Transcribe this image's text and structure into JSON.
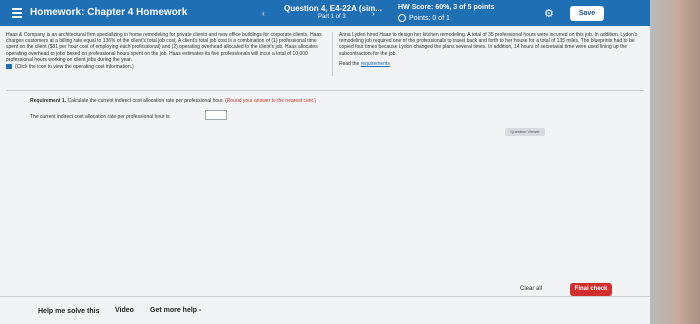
{
  "header": {
    "title": "Homework: Chapter 4 Homework",
    "question_title": "Question 4, E4-22A (sim...",
    "question_sub": "Part 1 of 3",
    "hw_score": "HW Score: 60%, 3 of 5 points",
    "points": "Points: 0 of 1",
    "save_label": "Save",
    "prev_icon": "‹",
    "next_icon": "›",
    "settings_icon": "⚙"
  },
  "problem": {
    "left_text": "Haas & Company is an architectural firm specializing in home remodeling for private clients and new office buildings for corporate clients. Haas charges customers at a billing rate equal to 136% of the client's total job cost. A client's total job cost is a combination of (1) professional time spent on the client ($81 per hour cost of employing each professional) and (2) operating overhead allocated to the client's job. Haas allocates operating overhead to jobs based on professional hours spent on the job. Haas estimates its five professionals will incur a total of 10,000 professional hours working on client jobs during the year.",
    "info_link": "(Click the icon to view the operating cost information.)",
    "right_text": "Anna Lydon hired Haas to design her kitchen remodeling. A total of 35 professional hours were incurred on this job. In addition, Lydon's remodeling job required one of the professionals to travel back and forth to her house for a total of 135 miles. The blueprints had to be copied four times because Lydon changed the plans several times. In addition, 14 hours of secretarial time were used lining up the subcontractors for the job.",
    "read_prefix": "Read the ",
    "requirements_link": "requirements"
  },
  "requirement": {
    "label": "Requirement 1.",
    "text": "Calculate the current indirect cost allocation rate per professional hour.",
    "note": "(Round your answer to the nearest cent.)",
    "answer_label": "The current indirect cost allocation rate per professional hour is",
    "answer_value": ""
  },
  "viewer": {
    "label": "Question Viewer"
  },
  "footer": {
    "clear_all": "Clear all",
    "final_check": "Final check",
    "help_me": "Help me solve this",
    "video": "Video",
    "get_more_help": "Get more help -"
  }
}
